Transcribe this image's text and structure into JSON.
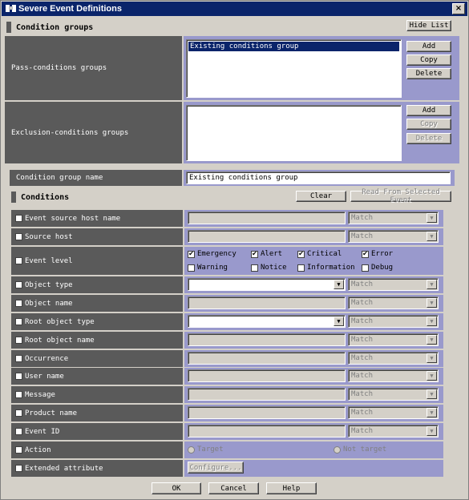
{
  "window": {
    "title": "Severe Event Definitions",
    "close": "×"
  },
  "condition_groups": {
    "header": "Condition groups",
    "hide_list": "Hide List",
    "pass": {
      "label": "Pass-conditions groups",
      "items": [
        "Existing conditions group"
      ],
      "add": "Add",
      "copy": "Copy",
      "delete": "Delete"
    },
    "exclusion": {
      "label": "Exclusion-conditions groups",
      "items": [],
      "add": "Add",
      "copy": "Copy",
      "delete": "Delete"
    }
  },
  "group_name": {
    "label": "Condition group name",
    "value": "Existing conditions group"
  },
  "conditions": {
    "header": "Conditions",
    "clear": "Clear",
    "read_from_event": "Read From Selected Event",
    "match": "Match",
    "rows": {
      "event_source_host": "Event source host name",
      "source_host": "Source host",
      "event_level": "Event level",
      "object_type": "Object type",
      "object_name": "Object name",
      "root_object_type": "Root object type",
      "root_object_name": "Root object name",
      "occurrence": "Occurrence",
      "user_name": "User name",
      "message": "Message",
      "product_name": "Product name",
      "event_id": "Event ID",
      "action": "Action",
      "extended_attribute": "Extended attribute"
    },
    "levels": {
      "emergency": "Emergency",
      "alert": "Alert",
      "critical": "Critical",
      "error": "Error",
      "warning": "Warning",
      "notice": "Notice",
      "information": "Information",
      "debug": "Debug"
    },
    "action_target": "Target",
    "action_not_target": "Not target",
    "configure": "Configure..."
  },
  "footer": {
    "ok": "OK",
    "cancel": "Cancel",
    "help": "Help"
  },
  "check": "✔"
}
